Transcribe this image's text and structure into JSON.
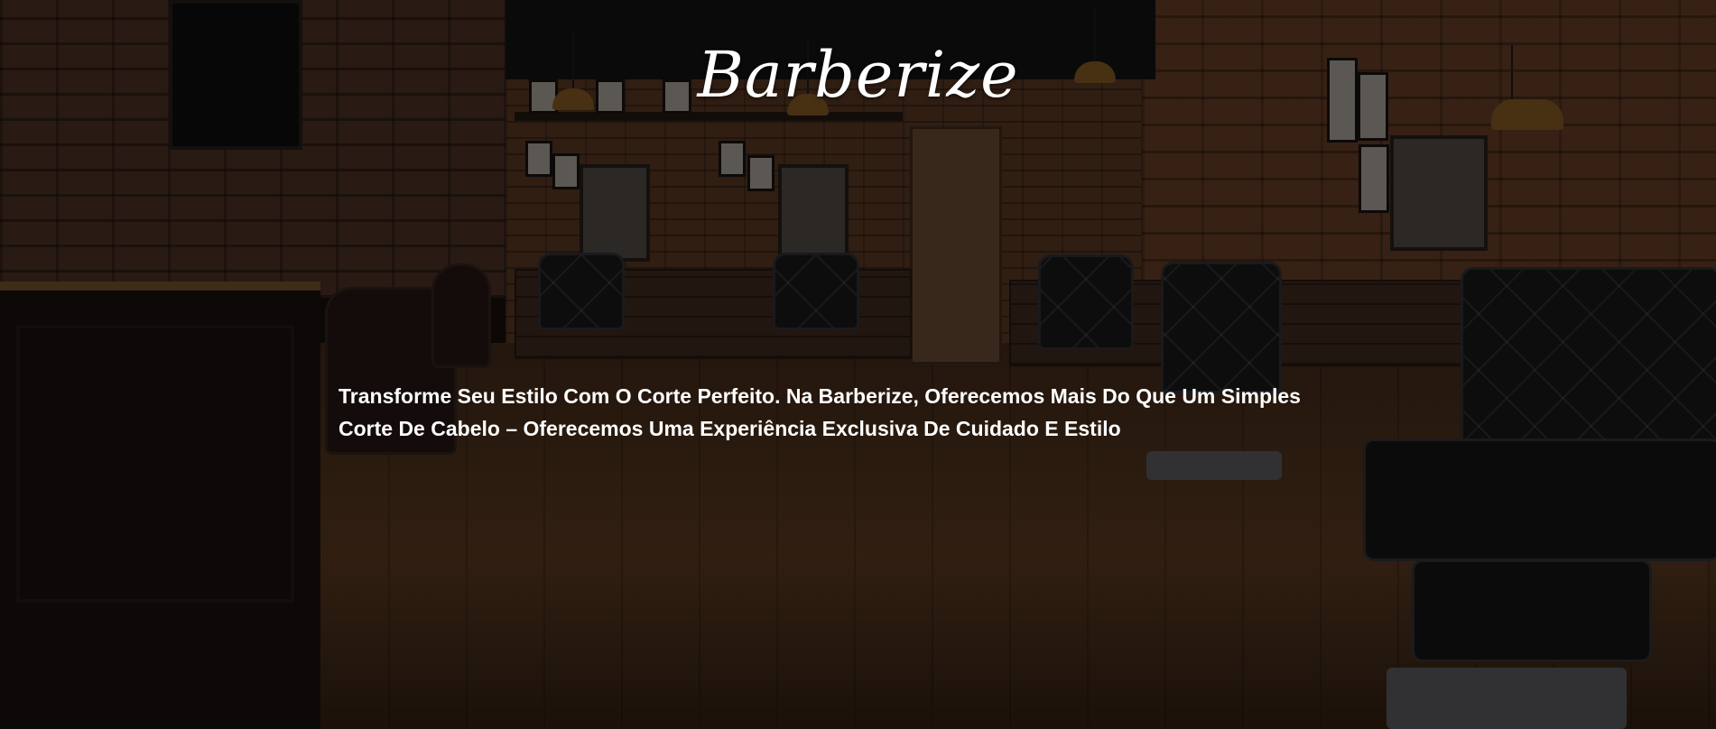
{
  "hero": {
    "brand_name": "Barberize",
    "tagline": "Transforme Seu Estilo Com O Corte Perfeito. Na Barberize, Oferecemos Mais Do Que Um Simples Corte De Cabelo – Oferecemos Uma Experiência Exclusiva De Cuidado E Estilo",
    "background": {
      "description_icon": "barbershop-interior-photo",
      "overlay_color": "#000000"
    }
  },
  "colors": {
    "text": "#ffffff",
    "brick": "#6a432c",
    "floor": "#5a3a22",
    "leather": "#1d1d20"
  }
}
